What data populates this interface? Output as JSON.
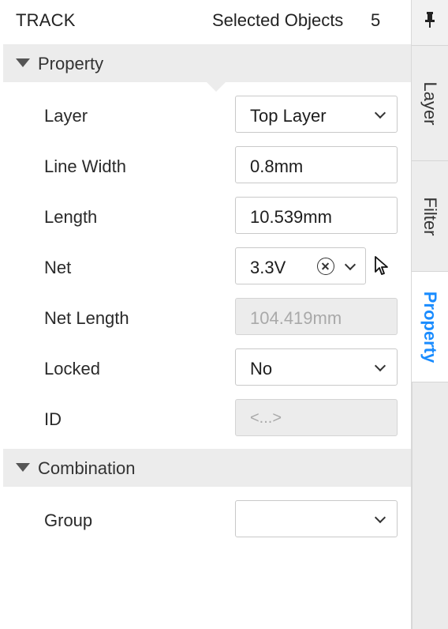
{
  "header": {
    "title": "TRACK",
    "selected_label": "Selected Objects",
    "selected_count": "5"
  },
  "sections": {
    "property": "Property",
    "combination": "Combination"
  },
  "fields": {
    "layer": {
      "label": "Layer",
      "value": "Top Layer"
    },
    "line_width": {
      "label": "Line Width",
      "value": "0.8mm"
    },
    "length": {
      "label": "Length",
      "value": "10.539mm"
    },
    "net": {
      "label": "Net",
      "value": "3.3V"
    },
    "net_length": {
      "label": "Net Length",
      "value": "104.419mm"
    },
    "locked": {
      "label": "Locked",
      "value": "No"
    },
    "id": {
      "label": "ID",
      "value": "<...>"
    },
    "group": {
      "label": "Group",
      "value": ""
    }
  },
  "side_tabs": {
    "layer": "Layer",
    "filter": "Filter",
    "property": "Property",
    "active": "Property"
  },
  "colors": {
    "accent": "#1a8cff",
    "section_bg": "#ececec",
    "disabled_bg": "#ececec"
  },
  "icons": [
    "pin-icon",
    "collapse-triangle-icon",
    "chevron-down-icon",
    "clear-circle-x-icon",
    "pointer-cursor-icon"
  ]
}
